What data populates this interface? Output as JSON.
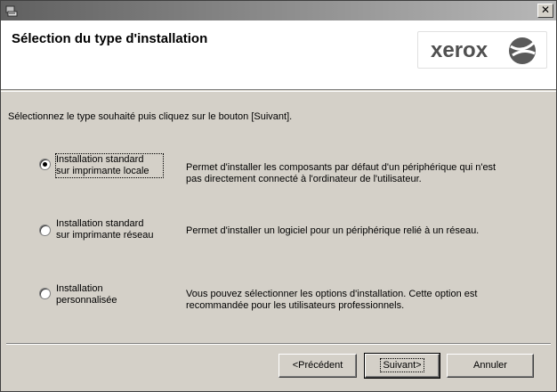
{
  "header": {
    "title": "Sélection du type d'installation",
    "logo_text": "xerox",
    "logo_colors": {
      "text": "#505050",
      "sphere": "#5a5a5a"
    }
  },
  "instruction": "Sélectionnez le type souhaité puis cliquez sur le bouton [Suivant].",
  "options": [
    {
      "label_line1": "Installation standard",
      "label_line2": "sur imprimante locale",
      "desc_line1": "Permet d'installer les composants par défaut d'un périphérique qui n'est",
      "desc_line2": "pas directement connecté à l'ordinateur de l'utilisateur.",
      "checked": true
    },
    {
      "label_line1": "Installation standard",
      "label_line2": "sur imprimante réseau",
      "desc_line1": "Permet d'installer un logiciel pour un périphérique relié à un réseau.",
      "desc_line2": "",
      "checked": false
    },
    {
      "label_line1": "Installation",
      "label_line2": "personnalisée",
      "desc_line1": "Vous pouvez sélectionner les options d'installation. Cette option est",
      "desc_line2": "recommandée pour les utilisateurs professionnels.",
      "checked": false
    }
  ],
  "buttons": {
    "back": "<Précédent",
    "next": "Suivant>",
    "cancel": "Annuler"
  },
  "titlebar": {
    "close_glyph": "✕"
  }
}
